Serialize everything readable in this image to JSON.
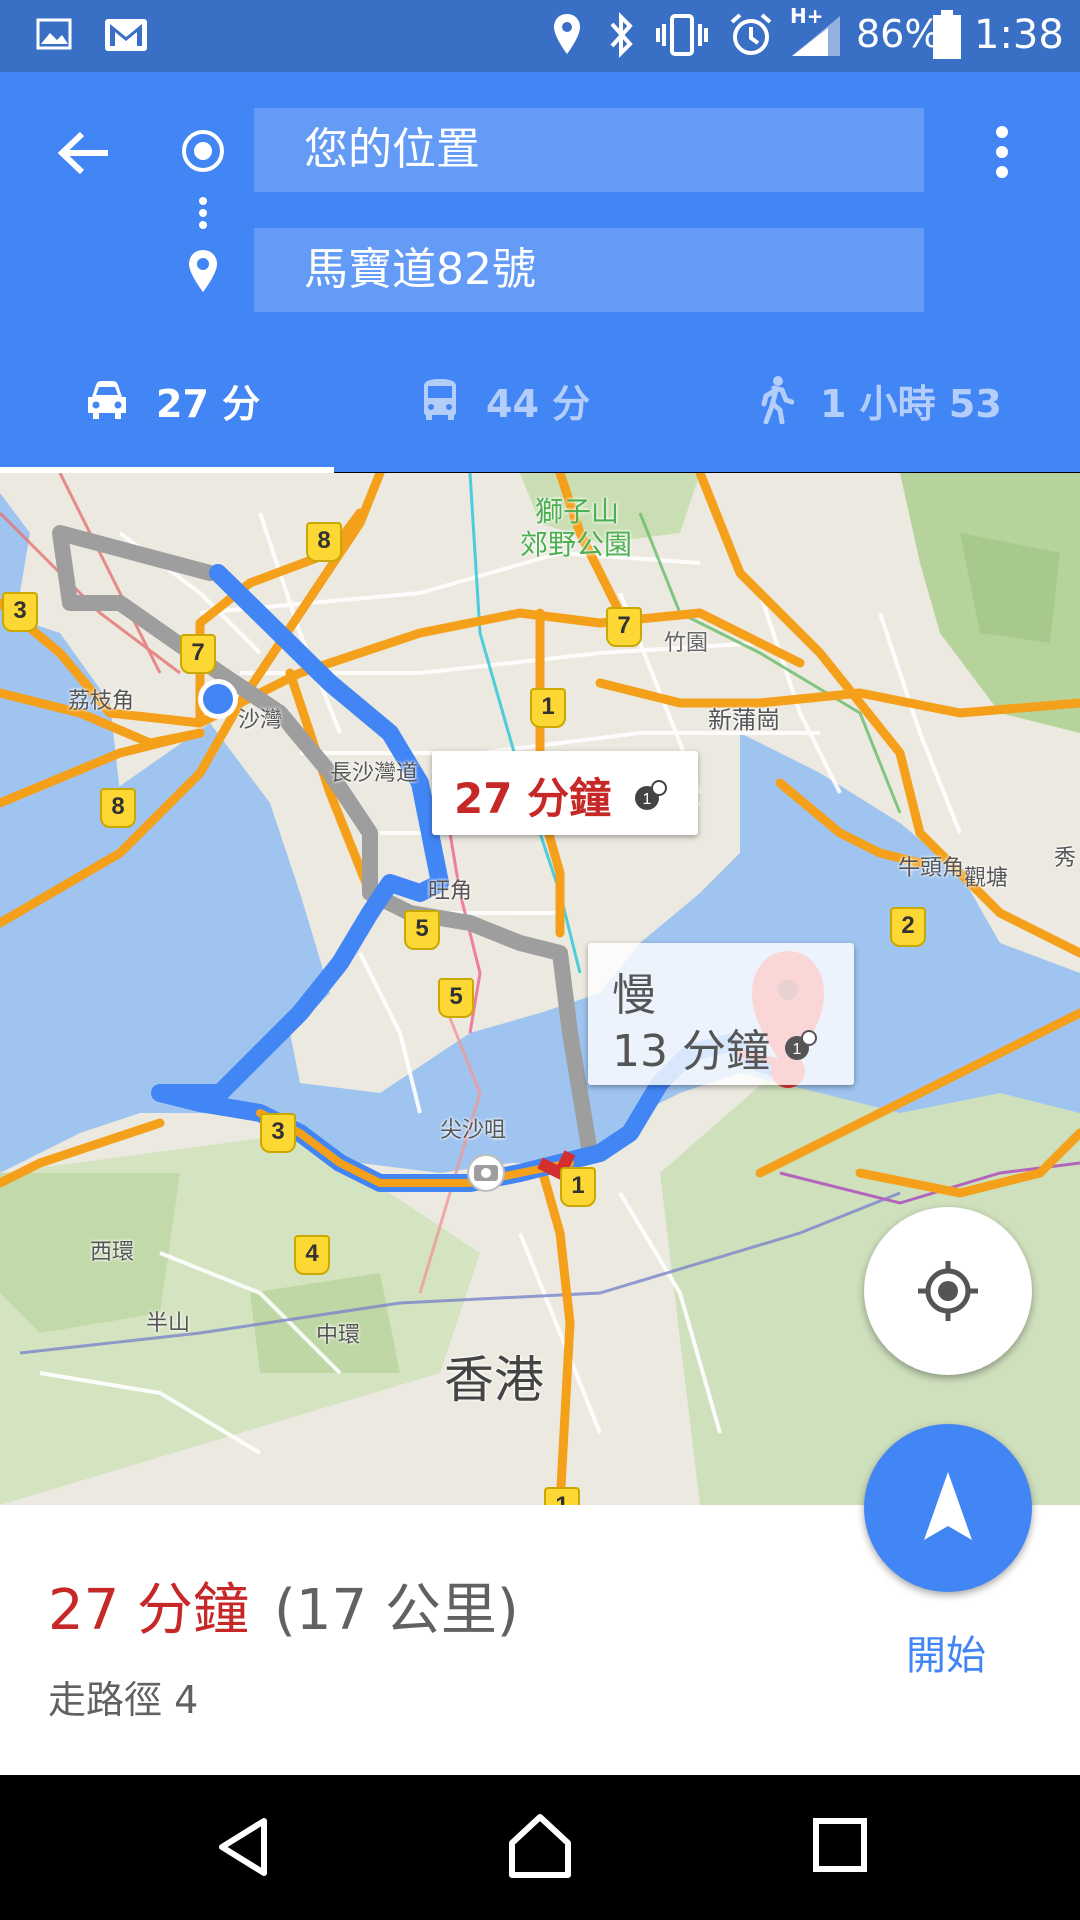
{
  "status_bar": {
    "battery_percent": "86%",
    "time": "1:38",
    "signal_type": "H+",
    "icons": [
      "image-icon",
      "gmail-icon",
      "location-icon",
      "bluetooth-icon",
      "vibrate-icon",
      "alarm-icon",
      "signal-icon",
      "battery-icon"
    ]
  },
  "directions": {
    "origin": "您的位置",
    "destination": "馬寶道82號",
    "modes": [
      {
        "name": "drive",
        "label": "27 分",
        "icon": "car-icon",
        "selected": true
      },
      {
        "name": "transit",
        "label": "44 分",
        "icon": "bus-icon",
        "selected": false
      },
      {
        "name": "walk",
        "label": "1 小時 53",
        "icon": "walk-icon",
        "selected": false
      }
    ]
  },
  "map": {
    "route_callout": {
      "time": "27 分鐘"
    },
    "alt_callout": {
      "status": "慢",
      "time": "13 分鐘"
    },
    "place_labels": [
      "獅子山",
      "郊野公園",
      "竹園",
      "新蒲崗",
      "荔枝角",
      "沙灣",
      "長沙灣道",
      "旺角",
      "牛頭角",
      "觀塘",
      "秀",
      "尖沙咀",
      "西環",
      "半山",
      "中環",
      "香港"
    ],
    "road_shields": [
      "8",
      "3",
      "7",
      "7",
      "1",
      "8",
      "5",
      "5",
      "2",
      "3",
      "1",
      "4",
      "1"
    ],
    "colors": {
      "route": "#4285f4",
      "alt_route": "#9e9e9e",
      "highway": "#f5a01a",
      "water": "#9fc4ef",
      "traffic_slow": "#e8a322",
      "traffic_jam": "#d32f2f"
    }
  },
  "summary": {
    "time": "27 分鐘",
    "distance": "(17 公里)",
    "via": "走路徑 4",
    "start_label": "開始"
  },
  "colors": {
    "accent": "#4285f4",
    "status_bar": "#3a6fc6",
    "time_red": "#c62828",
    "start_blue": "#4285f4"
  }
}
